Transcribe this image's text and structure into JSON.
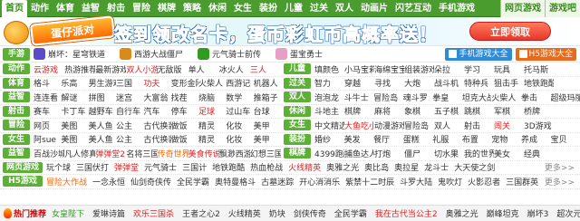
{
  "nav": {
    "items": [
      "首页",
      "动作",
      "体育",
      "益智",
      "射击",
      "冒险",
      "棋牌",
      "策略",
      "休闲",
      "女生",
      "装扮",
      "儿童",
      "过关",
      "双人",
      "动画片",
      "闪艺互动",
      "手机游戏"
    ],
    "right": [
      "网页游戏",
      "游戏吧"
    ]
  },
  "banner": {
    "badge": "蛋仔派对",
    "headline": "签到领改名卡，蛋币彩虹币高概率送！",
    "cta": "立即领取"
  },
  "apps": {
    "tag": "手游",
    "items": [
      {
        "label": "崩坏：星穹铁道",
        "color": "#5a4cc9"
      },
      {
        "label": "西游大战僵尸",
        "color": "#d98a1a"
      },
      {
        "label": "元气骑士前传",
        "color": "#2f9c1f"
      },
      {
        "label": "蛋宝勇士",
        "color": "#e6a0c8"
      }
    ],
    "buttons": [
      {
        "label": "手机游戏大全",
        "color": "#2f8ad8"
      },
      {
        "label": "H5游戏大全",
        "color": "#e96a1a"
      }
    ]
  },
  "rows": [
    {
      "ltag": "动作",
      "left": [
        [
          "云游戏",
          "red"
        ],
        [
          "热游推荐",
          ""
        ],
        [
          "最新游戏",
          ""
        ],
        [
          "双人小游戏",
          "red"
        ],
        [
          "无敌版",
          ""
        ],
        [
          "单人",
          ""
        ],
        [
          "冰火人",
          ""
        ],
        [
          "三人",
          "red"
        ]
      ],
      "rtag": "儿童",
      "right": [
        [
          "填颜色",
          ""
        ],
        [
          "小马宝莉",
          ""
        ],
        [
          "海绵宝宝",
          ""
        ],
        [
          "组装游戏",
          ""
        ],
        [
          "朵拉",
          ""
        ],
        [
          "学习",
          ""
        ],
        [
          "玩具",
          ""
        ],
        [
          "托马斯",
          ""
        ]
      ]
    },
    {
      "ltag": "体育",
      "left": [
        [
          "格斗",
          ""
        ],
        [
          "乐高",
          ""
        ],
        [
          "男生游戏",
          ""
        ],
        [
          "三国",
          ""
        ],
        [
          "功夫",
          "red"
        ],
        [
          "变形金刚",
          ""
        ],
        [
          "火柴人",
          ""
        ],
        [
          "西游记",
          ""
        ],
        [
          "机器人",
          ""
        ]
      ],
      "rtag": "过关",
      "right": [
        [
          "智力",
          ""
        ],
        [
          "穿越",
          ""
        ],
        [
          "寻找",
          ""
        ],
        [
          "大炮",
          ""
        ],
        [
          "战斗机",
          ""
        ],
        [
          "特种兵",
          ""
        ],
        [
          "狙击手",
          ""
        ],
        [
          "地铁跑酷",
          ""
        ]
      ]
    },
    {
      "ltag": "益智",
      "left": [
        [
          "连连看",
          ""
        ],
        [
          "解谜",
          ""
        ],
        [
          "拼图",
          ""
        ],
        [
          "迷宫",
          ""
        ],
        [
          "大富翁",
          ""
        ],
        [
          "找茬",
          ""
        ],
        [
          "烧脑",
          ""
        ],
        [
          "数学",
          ""
        ],
        [
          "推箱子",
          ""
        ]
      ],
      "rtag": "双人",
      "right": [
        [
          "泡泡龙",
          ""
        ],
        [
          "斗牛士",
          ""
        ],
        [
          "冒险岛",
          ""
        ],
        [
          "魂斗罗",
          ""
        ],
        [
          "拳皇",
          ""
        ],
        [
          "坦克大战",
          ""
        ],
        [
          "火柴人",
          ""
        ],
        [
          "拳击",
          ""
        ],
        [
          "超级玛丽",
          ""
        ]
      ]
    },
    {
      "ltag": "射击",
      "left": [
        [
          "赛车",
          ""
        ],
        [
          "卡丁车",
          ""
        ],
        [
          "越野车",
          ""
        ],
        [
          "自行车",
          ""
        ],
        [
          "汽车",
          ""
        ],
        [
          "停车",
          ""
        ],
        [
          "足球",
          "red"
        ],
        [
          "过山车",
          ""
        ],
        [
          "台球",
          ""
        ]
      ],
      "rtag": "休闲",
      "right": [
        [
          "斗地主",
          ""
        ],
        [
          "棋牌",
          ""
        ],
        [
          "麻将",
          ""
        ],
        [
          "象棋",
          ""
        ],
        [
          "五子棋",
          ""
        ],
        [
          "跳棋",
          ""
        ],
        [
          "军棋",
          ""
        ],
        [
          "桥牌",
          ""
        ]
      ]
    },
    {
      "ltag": "冒险",
      "left": [
        [
          "网页",
          ""
        ],
        [
          "美图",
          ""
        ],
        [
          "美人鱼",
          ""
        ],
        [
          "公主",
          ""
        ],
        [
          "古代换装",
          ""
        ],
        [
          "做饭",
          ""
        ],
        [
          "精灵",
          ""
        ],
        [
          "化妆",
          ""
        ],
        [
          "美甲",
          ""
        ]
      ],
      "rtag": "女生",
      "right": [
        [
          "中文精选",
          ""
        ],
        [
          "大鱼吃小鱼",
          "red"
        ],
        [
          "动漫游戏",
          ""
        ],
        [
          "冒险岛",
          ""
        ],
        [
          "双人",
          ""
        ],
        [
          "射击",
          ""
        ],
        [
          "闯关",
          "red"
        ],
        [
          "3D游戏",
          ""
        ]
      ]
    },
    {
      "ltag": "女生",
      "left": [
        [
          "阿sue",
          ""
        ],
        [
          "美图",
          ""
        ],
        [
          "美人鱼",
          ""
        ],
        [
          "公主",
          ""
        ],
        [
          "古代换装",
          ""
        ],
        [
          "做饭",
          ""
        ],
        [
          "精灵",
          ""
        ],
        [
          "化妆",
          ""
        ],
        [
          "美甲",
          ""
        ]
      ],
      "rtag": "装扮",
      "right": [
        [
          "婚纱",
          ""
        ],
        [
          "美发",
          ""
        ],
        [
          "餐厅",
          ""
        ],
        [
          "蛋糕",
          ""
        ],
        [
          "礼服",
          ""
        ],
        [
          "布置",
          ""
        ],
        [
          "宠物",
          ""
        ],
        [
          "养成",
          ""
        ],
        [
          "宝贝",
          ""
        ]
      ]
    },
    {
      "ltag": "益智",
      "left": [
        [
          "百战沙城",
          ""
        ],
        [
          "凡人修真",
          ""
        ],
        [
          "弹弹堂2",
          "red"
        ],
        [
          "名将三国",
          ""
        ],
        [
          "传奇世界",
          "orange"
        ],
        [
          "美食传说",
          "red"
        ],
        [
          "飘渺西游",
          ""
        ],
        [
          "幻想三国",
          ""
        ]
      ],
      "rtag": "棋牌",
      "right": [
        [
          "4399跑酷",
          ""
        ],
        [
          "捕鱼达人",
          ""
        ],
        [
          "打炮",
          ""
        ],
        [
          "僵尸",
          ""
        ],
        [
          "切水果",
          ""
        ],
        [
          "我的世界",
          ""
        ],
        [
          "美女",
          ""
        ],
        [
          "经典",
          ""
        ]
      ]
    }
  ],
  "wide_rows": [
    {
      "tag": "网页游戏",
      "items": [
        [
          "玩个球",
          ""
        ],
        [
          "三国伏打",
          ""
        ],
        [
          "弹弹堂",
          "red"
        ],
        [
          "元气骑士",
          ""
        ],
        [
          "三国计",
          ""
        ],
        [
          "地铁跑酷",
          ""
        ],
        [
          "热血枪战",
          ""
        ],
        [
          "火线精英",
          "red"
        ],
        [
          "奥雅之光",
          ""
        ],
        [
          "奥比岛",
          ""
        ],
        [
          "奥拉星",
          ""
        ],
        [
          "龙斗士",
          ""
        ],
        [
          "大天使之剑",
          ""
        ]
      ],
      "more": "更多>>"
    },
    {
      "tag": "H5游戏",
      "items": [
        [
          "冒险大作战",
          "orange"
        ],
        [
          "一念永恒",
          ""
        ],
        [
          "仙剑奇侠传",
          ""
        ],
        [
          "全民学霸",
          ""
        ],
        [
          "奥特曼格斗",
          ""
        ],
        [
          "古墓迷踪",
          ""
        ],
        [
          "开心消消乐",
          ""
        ],
        [
          "紫禁十二时辰",
          ""
        ],
        [
          "斗罗大陆",
          ""
        ],
        [
          "鬼吹灯",
          ""
        ],
        [
          "火影忍者",
          ""
        ],
        [
          "三国群英",
          ""
        ]
      ],
      "more": "更多>>"
    }
  ],
  "hot": {
    "title": "热门推荐",
    "items": [
      [
        "女皇陛下",
        "green"
      ],
      [
        "爱琳诗篇",
        ""
      ],
      [
        "欢乐三国杀",
        "red"
      ],
      [
        "王者之心2",
        ""
      ],
      [
        "火线精英",
        ""
      ],
      [
        "奶块",
        ""
      ],
      [
        "剑侠传奇",
        ""
      ],
      [
        "全民学霸",
        ""
      ],
      [
        "我在古代当公主2",
        "red"
      ],
      [
        "奥雅之光",
        ""
      ],
      [
        "巅峰坦克",
        ""
      ],
      [
        "崩坏3",
        ""
      ],
      [
        "超次元",
        ""
      ]
    ]
  }
}
